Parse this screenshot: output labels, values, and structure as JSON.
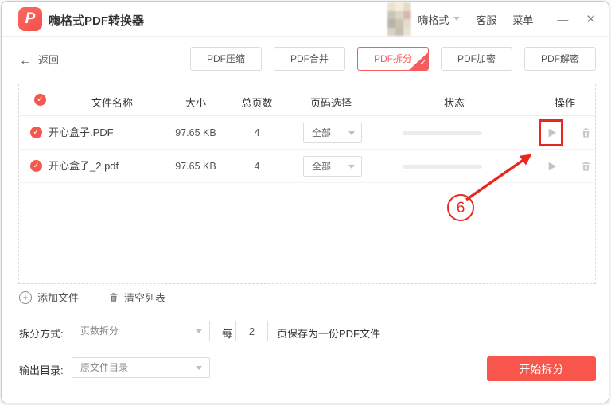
{
  "titlebar": {
    "app_title": "嗨格式PDF转换器",
    "account_name": "嗨格式",
    "service": "客服",
    "menu": "菜单",
    "minimize": "—",
    "close": "✕"
  },
  "toolbar": {
    "back_arrow": "←",
    "back_label": "返回",
    "tabs": [
      {
        "label": "PDF压缩",
        "active": false
      },
      {
        "label": "PDF合并",
        "active": false
      },
      {
        "label": "PDF拆分",
        "active": true
      },
      {
        "label": "PDF加密",
        "active": false
      },
      {
        "label": "PDF解密",
        "active": false
      }
    ]
  },
  "table": {
    "headers": {
      "name": "文件名称",
      "size": "大小",
      "pages": "总页数",
      "page_select": "页码选择",
      "status": "状态",
      "operation": "操作"
    },
    "rows": [
      {
        "name": "开心盒子.PDF",
        "size": "97.65 KB",
        "pages": "4",
        "page_select": "全部"
      },
      {
        "name": "开心盒子_2.pdf",
        "size": "97.65 KB",
        "pages": "4",
        "page_select": "全部"
      }
    ]
  },
  "list_actions": {
    "add_file": "添加文件",
    "clear_list": "清空列表"
  },
  "split_options": {
    "label": "拆分方式:",
    "method": "页数拆分",
    "every": "每",
    "pages_per_file": "2",
    "suffix": "页保存为一份PDF文件"
  },
  "output": {
    "label": "输出目录:",
    "value": "原文件目录"
  },
  "start_button": "开始拆分",
  "annotation": {
    "step_number": "6"
  },
  "icons": {
    "check": "✓",
    "tick": "✓",
    "plus": "+",
    "logo_letter": "P"
  },
  "colors": {
    "brand_red": "#f75c5c",
    "button_red": "#f8564c",
    "annotation_red": "#e8281e"
  }
}
